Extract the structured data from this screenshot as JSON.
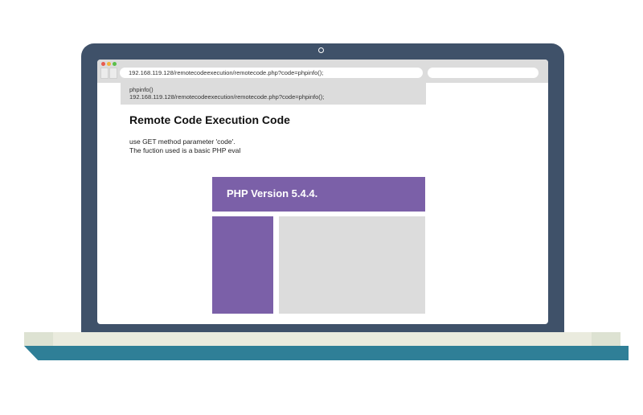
{
  "browser": {
    "url": "192.168.119.128/remotecodeexecution/remotecode.php?code=phpinfo();",
    "search_value": "",
    "suggestion": {
      "line1": "phpinfo()",
      "line2": "192.168.119.128/remotecodeexecution/remotecode.php?code=phpinfo();"
    }
  },
  "page": {
    "title": "Remote Code Execution Code",
    "description_line1": "use GET method parameter 'code'.",
    "description_line2": "The fuction used is a basic PHP eval"
  },
  "phpinfo": {
    "version_label": "PHP Version 5.4.4."
  },
  "colors": {
    "laptop_bezel": "#3f5169",
    "php_accent": "#7b60a8",
    "base_edge": "#2f7f97",
    "chrome_gray": "#dcdcdc"
  },
  "icons": [
    "close-dot-icon",
    "minimize-dot-icon",
    "maximize-dot-icon",
    "camera-icon"
  ]
}
